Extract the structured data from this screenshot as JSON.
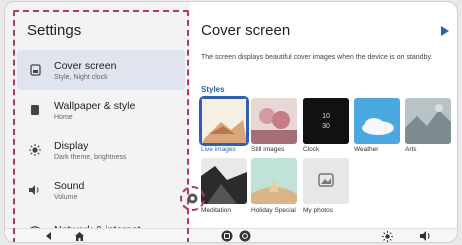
{
  "settings": {
    "title": "Settings",
    "items": [
      {
        "label": "Cover screen",
        "sub": "Style, Night clock",
        "icon": "cover-screen-icon",
        "active": true
      },
      {
        "label": "Wallpaper & style",
        "sub": "Home",
        "icon": "wallpaper-icon"
      },
      {
        "label": "Display",
        "sub": "Dark theme, brightness",
        "icon": "display-sun-icon"
      },
      {
        "label": "Sound",
        "sub": "Volume",
        "icon": "speaker-icon"
      },
      {
        "label": "Network & internet",
        "sub": "",
        "icon": "wifi-icon"
      }
    ]
  },
  "cover": {
    "title": "Cover screen",
    "description": "The screen displays beautiful cover images when the device is on standby.",
    "styles_label": "Styles",
    "tiles": [
      {
        "label": "Live images",
        "selected": true
      },
      {
        "label": "Still images"
      },
      {
        "label": "Clock",
        "clock_text": "10\n30"
      },
      {
        "label": "Weather"
      },
      {
        "label": "Arts"
      },
      {
        "label": "Meditation"
      },
      {
        "label": "Holiday Special"
      },
      {
        "label": "My photos"
      }
    ]
  },
  "colors": {
    "accent": "#2f5fb3",
    "highlight_dash": "#b23a5a",
    "active_item_bg": "#dfe4ee"
  }
}
